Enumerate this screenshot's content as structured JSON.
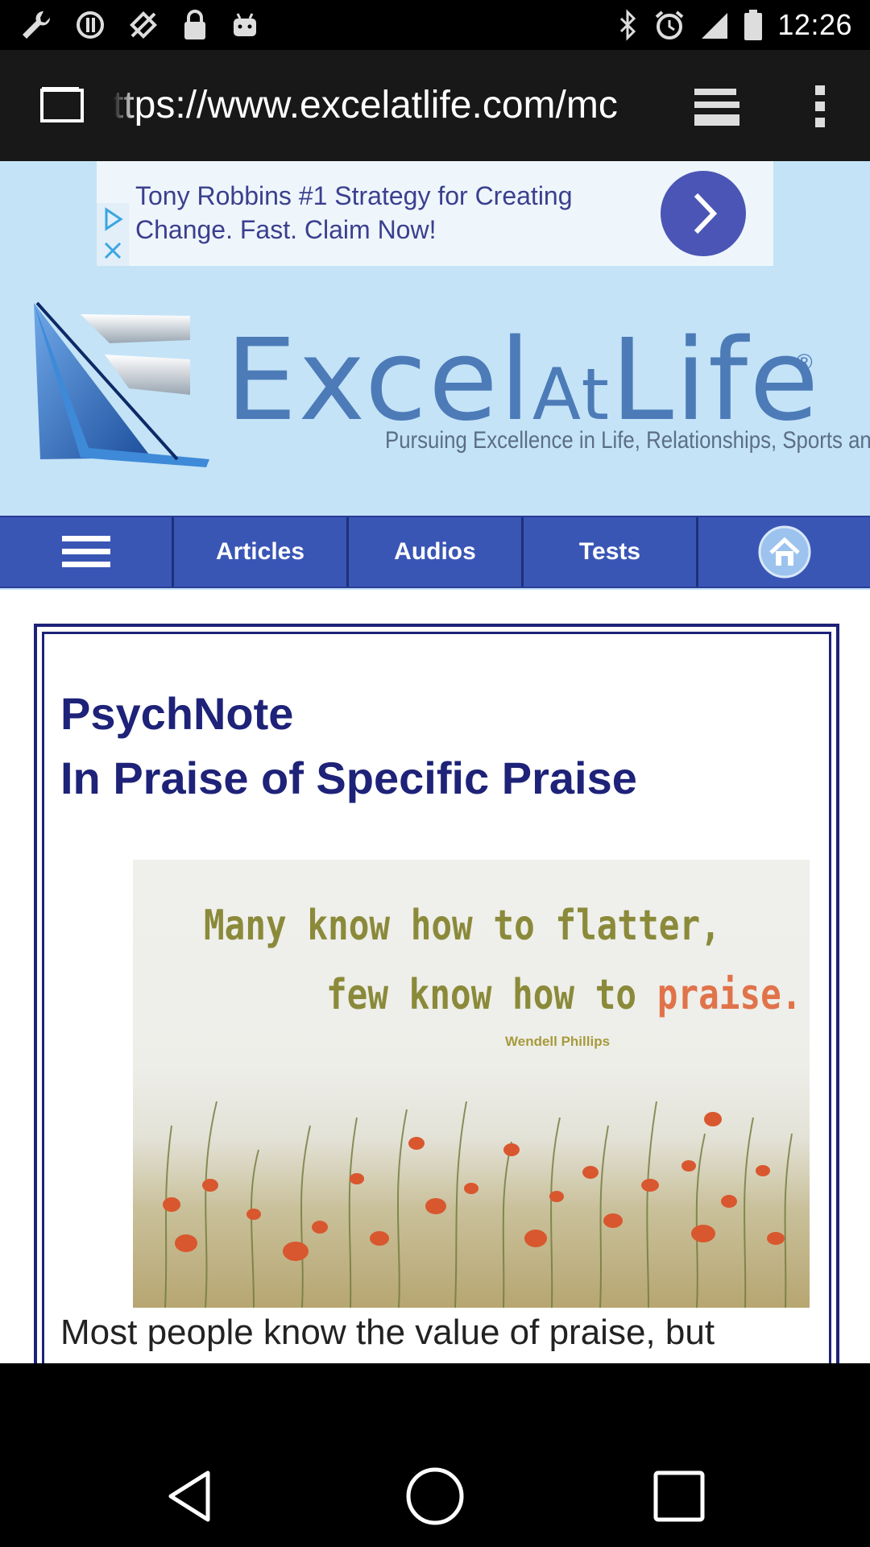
{
  "status_bar": {
    "time": "12:26",
    "left_icons": [
      "wrench-icon",
      "sync-icon",
      "no-sim-icon",
      "lock-icon",
      "android-icon"
    ],
    "right_icons": [
      "bluetooth-icon",
      "alarm-icon",
      "signal-icon",
      "battery-icon"
    ]
  },
  "browser": {
    "url": "ttps://www.excelatlife.com/mc",
    "reader_mode_icon": "reader-mode-icon",
    "menu_icon": "overflow-menu-icon"
  },
  "ad": {
    "text": "Tony Robbins #1 Strategy for Creating Change. Fast. Claim Now!",
    "go_icon": "chevron-right-icon"
  },
  "site": {
    "logo_word_1": "Excel",
    "logo_word_2": "At",
    "logo_word_3": "Life",
    "logo_reg": "®",
    "tagline": "Pursuing Excellence in Life, Relationships, Sports and Career"
  },
  "nav": {
    "items": [
      {
        "icon": "hamburger-icon"
      },
      {
        "label": "Articles"
      },
      {
        "label": "Audios"
      },
      {
        "label": "Tests"
      },
      {
        "icon": "home-icon"
      }
    ]
  },
  "article": {
    "kicker": "PsychNote",
    "title": "In Praise of Specific Praise",
    "image": {
      "quote_line1": "Many know how to flatter,",
      "quote_line2_start": "few know how to ",
      "quote_line2_accent": "praise.",
      "author": "Wendell Phillips"
    },
    "lede": "Most people know the value of praise, but"
  },
  "share": {
    "buttons": [
      "facebook-icon",
      "twitter-icon",
      "google-plus-icon"
    ]
  },
  "colors": {
    "accent_navy": "#1e2278",
    "nav_blue": "#3a56b5",
    "page_blue": "#c4e3f7"
  }
}
